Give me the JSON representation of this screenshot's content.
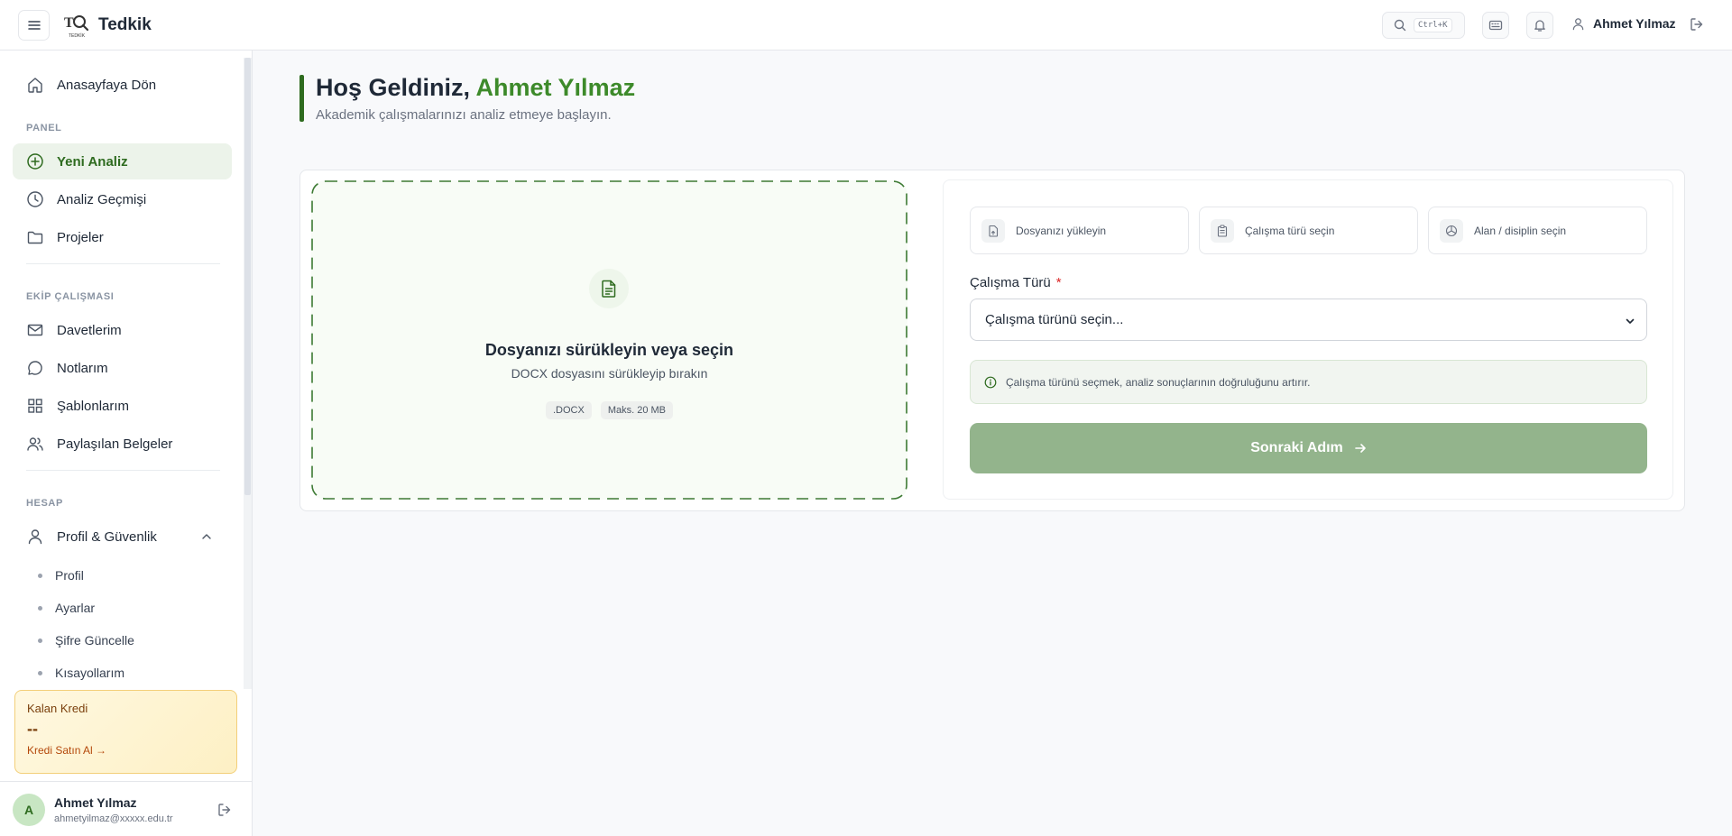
{
  "app": {
    "brand": "Tedkik",
    "logo_text": "TEDKİK"
  },
  "topbar": {
    "search_shortcut": "Ctrl+K",
    "user_name": "Ahmet Yılmaz"
  },
  "sidebar": {
    "home": "Anasayfaya Dön",
    "panel_label": "PANEL",
    "panel_items": [
      "Yeni Analiz",
      "Analiz Geçmişi",
      "Projeler"
    ],
    "team_label": "EKİP ÇALIŞMASI",
    "team_items": [
      "Davetlerim",
      "Notlarım",
      "Şablonlarım",
      "Paylaşılan Belgeler"
    ],
    "account_label": "HESAP",
    "account_group": "Profil & Güvenlik",
    "account_subitems": [
      "Profil",
      "Ayarlar",
      "Şifre Güncelle",
      "Kısayollarım"
    ],
    "credit": {
      "title": "Kalan Kredi",
      "value": "--",
      "link": "Kredi Satın Al →"
    },
    "user": {
      "initial": "A",
      "name": "Ahmet Yılmaz",
      "email": "ahmetyilmaz@xxxxx.edu.tr"
    }
  },
  "main": {
    "welcome_prefix": "Hoş Geldiniz, ",
    "welcome_name": "Ahmet Yılmaz",
    "welcome_sub": "Akademik çalışmalarınızı analiz etmeye başlayın.",
    "dropzone": {
      "title": "Dosyanızı sürükleyin veya seçin",
      "subtitle": "DOCX dosyasını sürükleyip bırakın",
      "badges": [
        ".DOCX",
        "Maks. 20 MB"
      ]
    },
    "steps": [
      "Dosyanızı yükleyin",
      "Çalışma türü seçin",
      "Alan / disiplin seçin"
    ],
    "field_label": "Çalışma Türü",
    "required_mark": "*",
    "select_placeholder": "Çalışma türünü seçin...",
    "info_text": "Çalışma türünü seçmek, analiz sonuçlarının doğruluğunu artırır.",
    "next_button": "Sonraki Adım"
  },
  "colors": {
    "accent": "#2e6b1f",
    "accent_light": "#3d8a2a",
    "button_disabled": "#93b48c"
  }
}
